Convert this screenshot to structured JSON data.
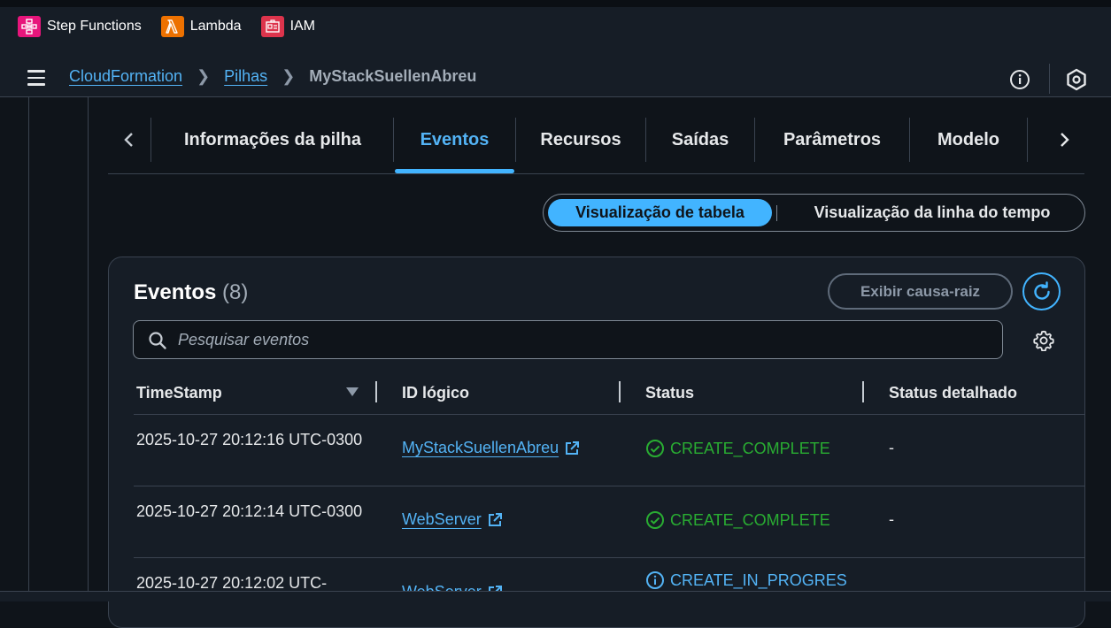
{
  "favorites": [
    {
      "label": "Step Functions",
      "icon": "step-functions-icon",
      "color": "#e7157b"
    },
    {
      "label": "Lambda",
      "icon": "lambda-icon",
      "color": "#ed7100"
    },
    {
      "label": "IAM",
      "icon": "iam-icon",
      "color": "#dd344c"
    }
  ],
  "breadcrumb": {
    "items": [
      "CloudFormation",
      "Pilhas"
    ],
    "current": "MyStackSuellenAbreu"
  },
  "tabs": [
    {
      "label": "Informações da pilha",
      "active": false
    },
    {
      "label": "Eventos",
      "active": true
    },
    {
      "label": "Recursos",
      "active": false
    },
    {
      "label": "Saídas",
      "active": false
    },
    {
      "label": "Parâmetros",
      "active": false
    },
    {
      "label": "Modelo",
      "active": false
    }
  ],
  "view_toggle": {
    "table": "Visualização de tabela",
    "timeline": "Visualização da linha do tempo",
    "selected": "table"
  },
  "events": {
    "title": "Eventos",
    "count": "(8)",
    "root_cause_button": "Exibir causa-raiz",
    "search_placeholder": "Pesquisar eventos",
    "columns": [
      "TimeStamp",
      "ID lógico",
      "Status",
      "Status detalhado"
    ],
    "rows": [
      {
        "timestamp": "2025-10-27 20:12:16 UTC-0300",
        "logical_id": "MyStackSuellenAbreu",
        "status": "CREATE_COMPLETE",
        "status_type": "success",
        "detail": "-"
      },
      {
        "timestamp": "2025-10-27 20:12:14 UTC-0300",
        "logical_id": "WebServer",
        "status": "CREATE_COMPLETE",
        "status_type": "success",
        "detail": "-"
      },
      {
        "timestamp": "2025-10-27 20:12:02 UTC-",
        "logical_id": "WebServer",
        "status": "CREATE_IN_PROGRES",
        "status_type": "info",
        "detail": ""
      }
    ]
  },
  "colors": {
    "accent": "#42b4ff",
    "link": "#53b3f5",
    "success": "#29ad32"
  }
}
